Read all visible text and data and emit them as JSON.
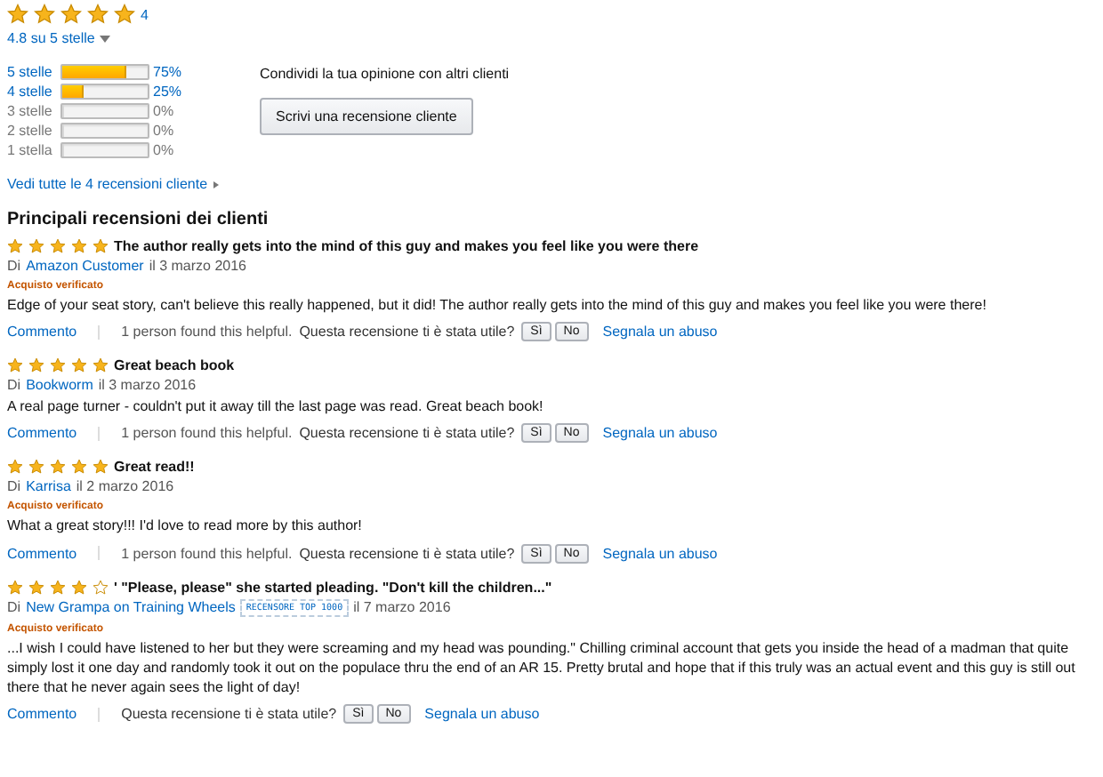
{
  "summary": {
    "stars": 5,
    "count": "4",
    "average": "4.8 su 5 stelle"
  },
  "histogram": [
    {
      "label": "5 stelle",
      "level": 0.75,
      "percent": "75%",
      "active": true
    },
    {
      "label": "4 stelle",
      "level": 0.25,
      "percent": "25%",
      "active": true
    },
    {
      "label": "3 stelle",
      "level": 0,
      "percent": "0%",
      "active": false
    },
    {
      "label": "2 stelle",
      "level": 0,
      "percent": "0%",
      "active": false
    },
    {
      "label": "1 stella",
      "level": 0,
      "percent": "0%",
      "active": false
    }
  ],
  "share": {
    "text": "Condividi la tua opinione con altri clienti",
    "button": "Scrivi una recensione cliente"
  },
  "see_all": "Vedi tutte le 4 recensioni cliente",
  "heading": "Principali recensioni dei clienti",
  "reviews": [
    {
      "stars": 5,
      "title": "The author really gets into the mind of this guy and makes you feel like you were there",
      "by": "Di",
      "author": "Amazon Customer",
      "date": "il 3 marzo 2016",
      "verified": "Acquisto verificato",
      "body": "Edge of your seat story, can't believe this really happened, but it did! The author really gets into the mind of this guy and makes you feel like you were there!",
      "comment": "Commento",
      "helpful": "1 person found this helpful.",
      "question": "Questa recensione ti è stata utile?",
      "yes": "Sì",
      "no": "No",
      "report": "Segnala un abuso"
    },
    {
      "stars": 5,
      "title": "Great beach book",
      "by": "Di",
      "author": "Bookworm",
      "date": "il 3 marzo 2016",
      "body": "A real page turner - couldn't put it away till the last page was read. Great beach book!",
      "comment": "Commento",
      "helpful": "1 person found this helpful.",
      "question": "Questa recensione ti è stata utile?",
      "yes": "Sì",
      "no": "No",
      "report": "Segnala un abuso"
    },
    {
      "stars": 5,
      "title": "Great read!!",
      "by": "Di",
      "author": "Karrisa",
      "date": "il 2 marzo 2016",
      "verified": "Acquisto verificato",
      "body": "What a great story!!! I'd love to read more by this author!",
      "comment": "Commento",
      "helpful": "1 person found this helpful.",
      "question": "Questa recensione ti è stata utile?",
      "yes": "Sì",
      "no": "No",
      "report": "Segnala un abuso"
    },
    {
      "stars": 4,
      "title": "' \"Please, please\" she started pleading. \"Don't kill the children...\"",
      "by": "Di",
      "author": "New Grampa on Training Wheels",
      "badge": "RECENSORE TOP 1000",
      "date": "il 7 marzo 2016",
      "verified": "Acquisto verificato",
      "body": "...I wish I could have listened to her but they were screaming and my head was pounding.\" Chilling criminal account that gets you inside the head of a madman that quite simply lost it one day and randomly took it out on the populace thru the end of an AR 15. Pretty brutal and hope that if this truly was an actual event and this guy is still out there that he never again sees the light of day!",
      "comment": "Commento",
      "question": "Questa recensione ti è stata utile?",
      "yes": "Sì",
      "no": "No",
      "report": "Segnala un abuso"
    }
  ]
}
